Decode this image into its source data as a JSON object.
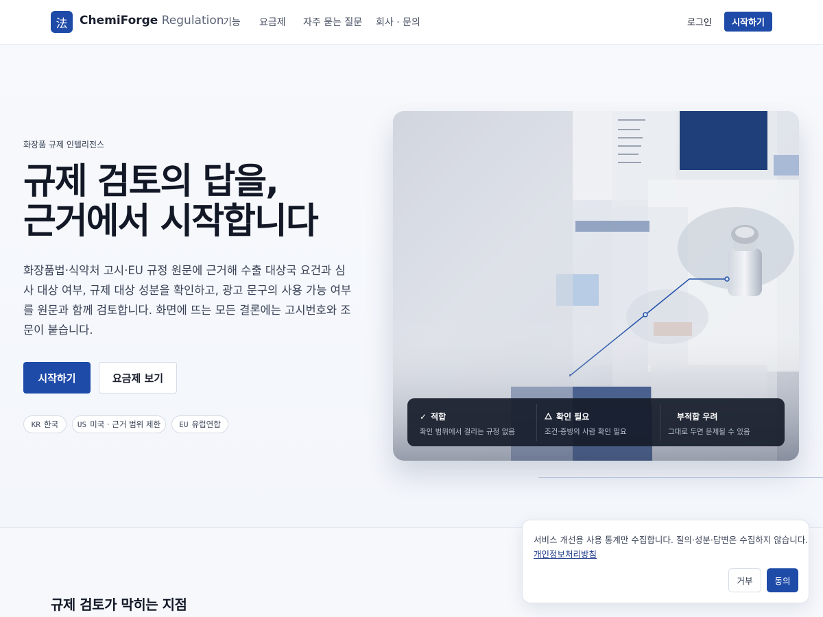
{
  "header": {
    "logo_glyph": "法",
    "brand_name": "ChemiForge",
    "brand_sub": "Regulation",
    "nav": [
      "기능",
      "요금제",
      "자주 묻는 질문",
      "회사 · 문의"
    ],
    "login": "로그인",
    "start": "시작하기"
  },
  "hero": {
    "eyebrow": "화장품 규제 인텔리전스",
    "headline_line1": "규제 검토의 답을,",
    "headline_line2": "근거에서 시작합니다",
    "description": "화장품법·식약처 고시·EU 규정 원문에 근거해 수출 대상국 요건과 심사 대상 여부, 규제 대상 성분을 확인하고, 광고 문구의 사용 가능 여부를 원문과 함께 검토합니다. 화면에 뜨는 모든 결론에는 고시번호와 조문이 붙습니다.",
    "primary_cta": "시작하기",
    "secondary_cta": "요금제 보기",
    "pills": [
      {
        "code": "KR",
        "label": "한국"
      },
      {
        "code": "US",
        "label": "미국 · 근거 범위 제한"
      },
      {
        "code": "EU",
        "label": "유럽연합"
      }
    ]
  },
  "status_panel": {
    "items": [
      {
        "icon": "check-icon",
        "title": "적합",
        "desc": "확인 범위에서 걸리는 규정 없음"
      },
      {
        "icon": "warning-triangle-icon",
        "title": "확인 필요",
        "desc": "조건·증빙의 사람 확인 필요"
      },
      {
        "icon": "",
        "title": "부적합 우려",
        "desc": "그대로 두면 문제될 수 있음"
      }
    ]
  },
  "section": {
    "title": "규제 검토가 막히는 지점"
  },
  "cookie": {
    "text": "서비스 개선용 사용 통계만 수집합니다. 질의·성분·답변은 수집하지 않습니다.",
    "link": "개인정보처리방침",
    "reject": "거부",
    "accept": "동의"
  },
  "colors": {
    "accent": "#1e4aa8",
    "text": "#121826"
  }
}
